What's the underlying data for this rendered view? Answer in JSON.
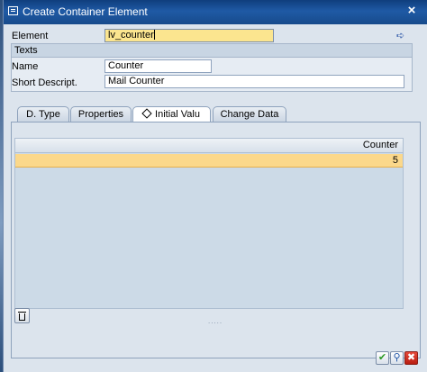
{
  "window": {
    "title": "Create Container Element",
    "close_glyph": "×",
    "icon": "create-element-icon"
  },
  "form": {
    "element_label": "Element",
    "element_value": "lv_counter",
    "texts_group_title": "Texts",
    "name_label": "Name",
    "name_value": "Counter",
    "short_descript_label": "Short Descript.",
    "short_descript_value": "Mail Counter",
    "nav_icon": "forward-navigate-icon",
    "nav_glyph": "➪"
  },
  "tabs": [
    {
      "label": "D. Type"
    },
    {
      "label": "Properties"
    },
    {
      "label": "Initial Valu",
      "active": true
    },
    {
      "label": "Change Data"
    }
  ],
  "grid": {
    "columns": [
      "Counter"
    ],
    "rows": [
      [
        "5"
      ]
    ],
    "selected_row_color": "#fbd88b",
    "resize_glyph": "....."
  },
  "toolbar": {
    "delete_icon": "trash-icon"
  },
  "footer": {
    "ok_glyph": "✔",
    "find_glyph": "⚲",
    "cancel_glyph": "✖"
  },
  "colors": {
    "title_bar": "#1f5aa5",
    "focus_field": "#fbe58f",
    "background": "#dce4ed"
  }
}
